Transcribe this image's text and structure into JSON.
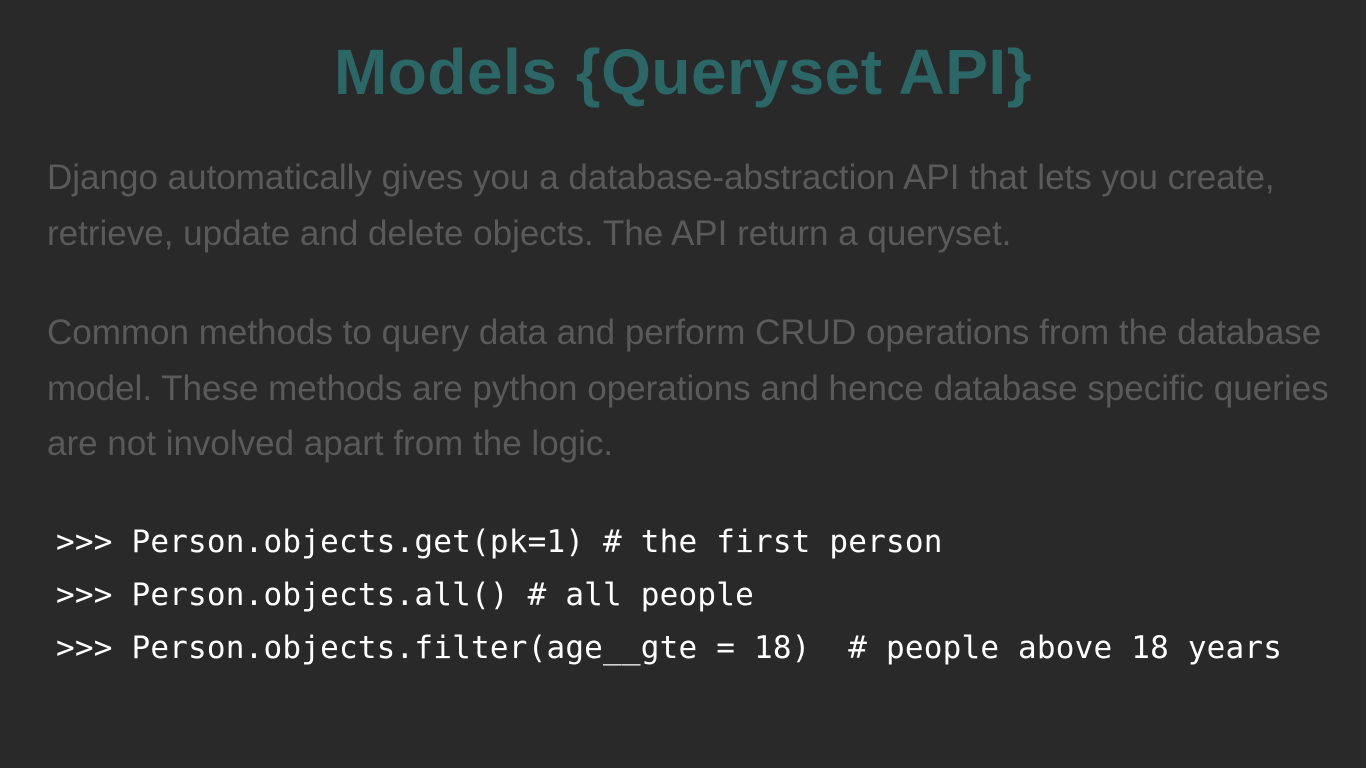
{
  "slide": {
    "title": "Models {Queryset API}",
    "paragraphs": [
      "Django automatically gives you a database-abstraction API that lets you create, retrieve, update and delete objects. The API return a queryset.",
      "Common methods to query data and perform CRUD operations from the database model. These methods are python operations and hence database specific queries are not involved apart from the logic."
    ],
    "code_lines": [
      ">>> Person.objects.get(pk=1) # the first person",
      ">>> Person.objects.all() # all people",
      ">>> Person.objects.filter(age__gte = 18)  # people above 18 years"
    ]
  },
  "colors": {
    "background": "#292929",
    "title": "#2a6766",
    "body_text": "#5a5a5a",
    "code_text": "#ffffff"
  }
}
